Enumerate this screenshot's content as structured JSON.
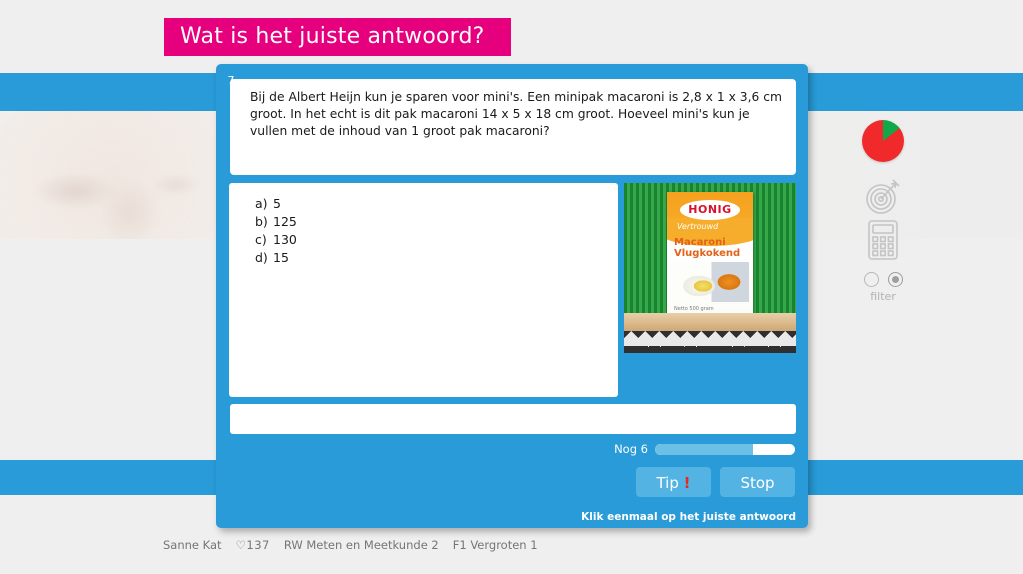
{
  "banner": {
    "title": "Wat is het juiste antwoord?"
  },
  "question": {
    "number": "7",
    "text": "Bij de Albert Heijn kun je sparen voor mini's. Een minipak macaroni is 2,8 x 1 x 3,6 cm groot. In het echt is dit pak macaroni 14 x 5 x 18 cm groot. Hoeveel mini's kun je vullen met de inhoud van 1 groot pak macaroni?"
  },
  "options": [
    {
      "letter": "a)",
      "value": "5"
    },
    {
      "letter": "b)",
      "value": "125"
    },
    {
      "letter": "c)",
      "value": "130"
    },
    {
      "letter": "d)",
      "value": "15"
    }
  ],
  "product_image": {
    "brand": "HONIG",
    "tagline": "Vertrouwd",
    "name_line1": "Macaroni",
    "name_line2": "Vlugkokend",
    "fineprint": "Netto\n500 gram"
  },
  "answer_input": {
    "value": "",
    "placeholder": ""
  },
  "progress": {
    "label": "Nog 6",
    "percent": 70
  },
  "buttons": {
    "tip": "Tip",
    "tip_mark": "!",
    "stop": "Stop"
  },
  "hint": "Klik eenmaal op het juiste antwoord",
  "toolbar": {
    "pie_icon": "pie-chart-icon",
    "target_icon": "target-icon",
    "calculator_icon": "calculator-icon",
    "filter_label": "filter"
  },
  "footer": {
    "user": "Sanne Kat",
    "hearts": "♡137",
    "course": "RW Meten en Meetkunde 2",
    "lesson": "F1 Vergroten 1"
  },
  "colors": {
    "dialog_blue": "#289bd8",
    "banner_pink": "#e6007e",
    "button_blue": "#53b3e3",
    "pie_red": "#f02a2a",
    "pie_green": "#11a84a"
  }
}
